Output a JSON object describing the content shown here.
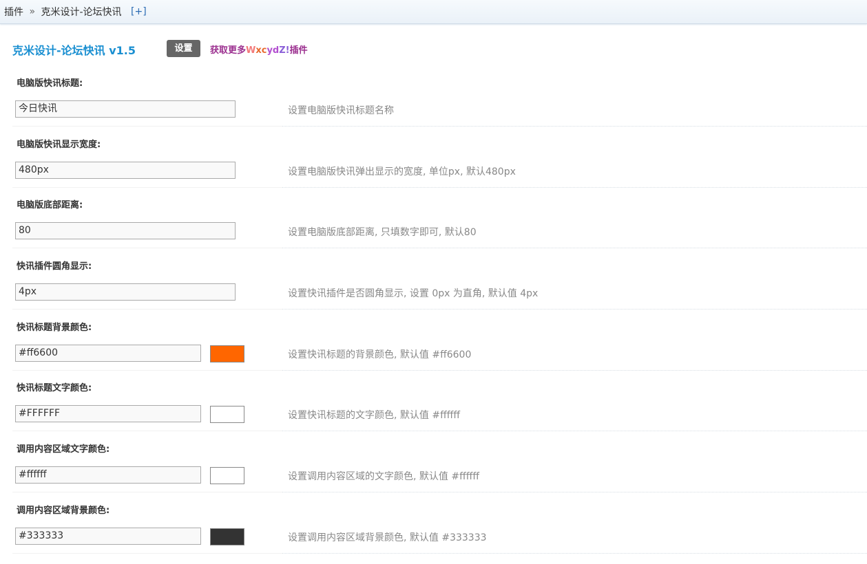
{
  "breadcrumb": {
    "root": "插件",
    "separator": "»",
    "current": "克米设计-论坛快讯",
    "plus": "[+]"
  },
  "header": {
    "title": "克米设计-论坛快讯 v1.5",
    "setting_button": "设置",
    "more_link": {
      "prefix": "获取更多",
      "w1": "W",
      "w2": "xc",
      "w3": "yd",
      "w4": "Z!",
      "suffix": "插件"
    }
  },
  "settings": [
    {
      "label": "电脑版快讯标题:",
      "value": "今日快讯",
      "desc": "设置电脑版快讯标题名称"
    },
    {
      "label": "电脑版快讯显示宽度:",
      "value": "480px",
      "desc": "设置电脑版快讯弹出显示的宽度, 单位px, 默认480px"
    },
    {
      "label": "电脑版底部距离:",
      "value": "80",
      "desc": "设置电脑版底部距离, 只填数字即可, 默认80"
    },
    {
      "label": "快讯插件圆角显示:",
      "value": "4px",
      "desc": "设置快讯插件是否圆角显示, 设置 0px 为直角, 默认值 4px"
    },
    {
      "label": "快讯标题背景颜色:",
      "value": "#ff6600",
      "desc": "设置快讯标题的背景颜色, 默认值 #ff6600",
      "swatch": "#ff6600"
    },
    {
      "label": "快讯标题文字颜色:",
      "value": "#FFFFFF",
      "desc": "设置快讯标题的文字颜色, 默认值 #ffffff",
      "swatch": "#ffffff"
    },
    {
      "label": "调用内容区域文字颜色:",
      "value": "#ffffff",
      "desc": "设置调用内容区域的文字颜色, 默认值 #ffffff",
      "swatch": "#ffffff"
    },
    {
      "label": "调用内容区域背景颜色:",
      "value": "#333333",
      "desc": "设置调用内容区域背景颜色, 默认值 #333333",
      "swatch": "#333333"
    }
  ]
}
